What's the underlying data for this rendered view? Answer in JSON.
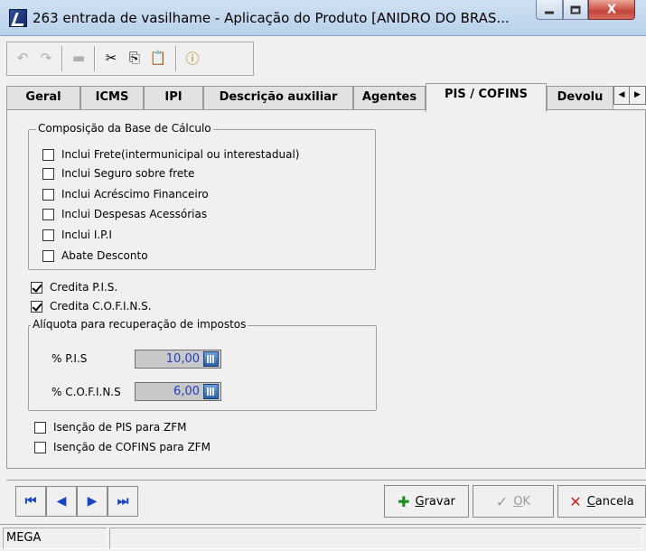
{
  "window": {
    "title": "263 entrada de vasilhame -  Aplicação do Produto [ANIDRO DO BRAS...",
    "minimize_label": "",
    "maximize_label": "",
    "close_label": "X"
  },
  "toolbar": {
    "undo_icon": "↶",
    "redo_icon": "↷",
    "delete_icon": "▬",
    "cut_icon": "✂",
    "copy_icon": "⎘",
    "paste_icon": "📋",
    "info_icon": "ⓘ"
  },
  "tabs": [
    {
      "label": "Geral",
      "active": false
    },
    {
      "label": "ICMS",
      "active": false
    },
    {
      "label": "IPI",
      "active": false
    },
    {
      "label": "Descrição auxiliar",
      "active": false
    },
    {
      "label": "Agentes",
      "active": false
    },
    {
      "label": "PIS / COFINS",
      "active": true
    },
    {
      "label": "Devolu",
      "active": false
    }
  ],
  "tab_scroll": {
    "left": "◀",
    "right": "▶"
  },
  "composicao": {
    "legend": "Composição da Base de Cálculo",
    "items": [
      {
        "label": "Inclui Frete(intermunicipal ou interestadual)",
        "checked": false
      },
      {
        "label": "Inclui Seguro sobre frete",
        "checked": false
      },
      {
        "label": "Inclui Acréscimo Financeiro",
        "checked": false
      },
      {
        "label": "Inclui Despesas Acessórias",
        "checked": false
      },
      {
        "label": "Inclui I.P.I",
        "checked": false
      },
      {
        "label": "Abate Desconto",
        "checked": false
      }
    ]
  },
  "credita": {
    "pis": {
      "label": "Credita P.I.S.",
      "checked": true
    },
    "cofins": {
      "label": "Credita C.O.F.I.N.S.",
      "checked": true
    }
  },
  "aliquota": {
    "legend": "Alíquota para recuperação de impostos",
    "pis_label": "% P.I.S",
    "pis_value": "10,00",
    "cofins_label": "% C.O.F.I.N.S",
    "cofins_value": "6,00"
  },
  "isencao": {
    "pis": {
      "label": "Isenção de PIS para ZFM",
      "checked": false
    },
    "cofins": {
      "label": "Isenção de COFINS para ZFM",
      "checked": false
    }
  },
  "navigation": {
    "first": "⏮",
    "prev": "◀",
    "next": "▶",
    "last": "⏭"
  },
  "actions": {
    "gravar_prefix": "",
    "gravar_underline": "G",
    "gravar_rest": "ravar",
    "ok_underline": "O",
    "ok_rest": "K",
    "cancela_underline": "C",
    "cancela_rest": "ancela",
    "gravar_icon": "✚",
    "ok_icon": "✓",
    "cancela_icon": "✕",
    "gravar_color": "#1f8f1f",
    "cancela_color": "#d21e1e"
  },
  "statusbar": {
    "cell1": "MEGA",
    "cell2": ""
  }
}
